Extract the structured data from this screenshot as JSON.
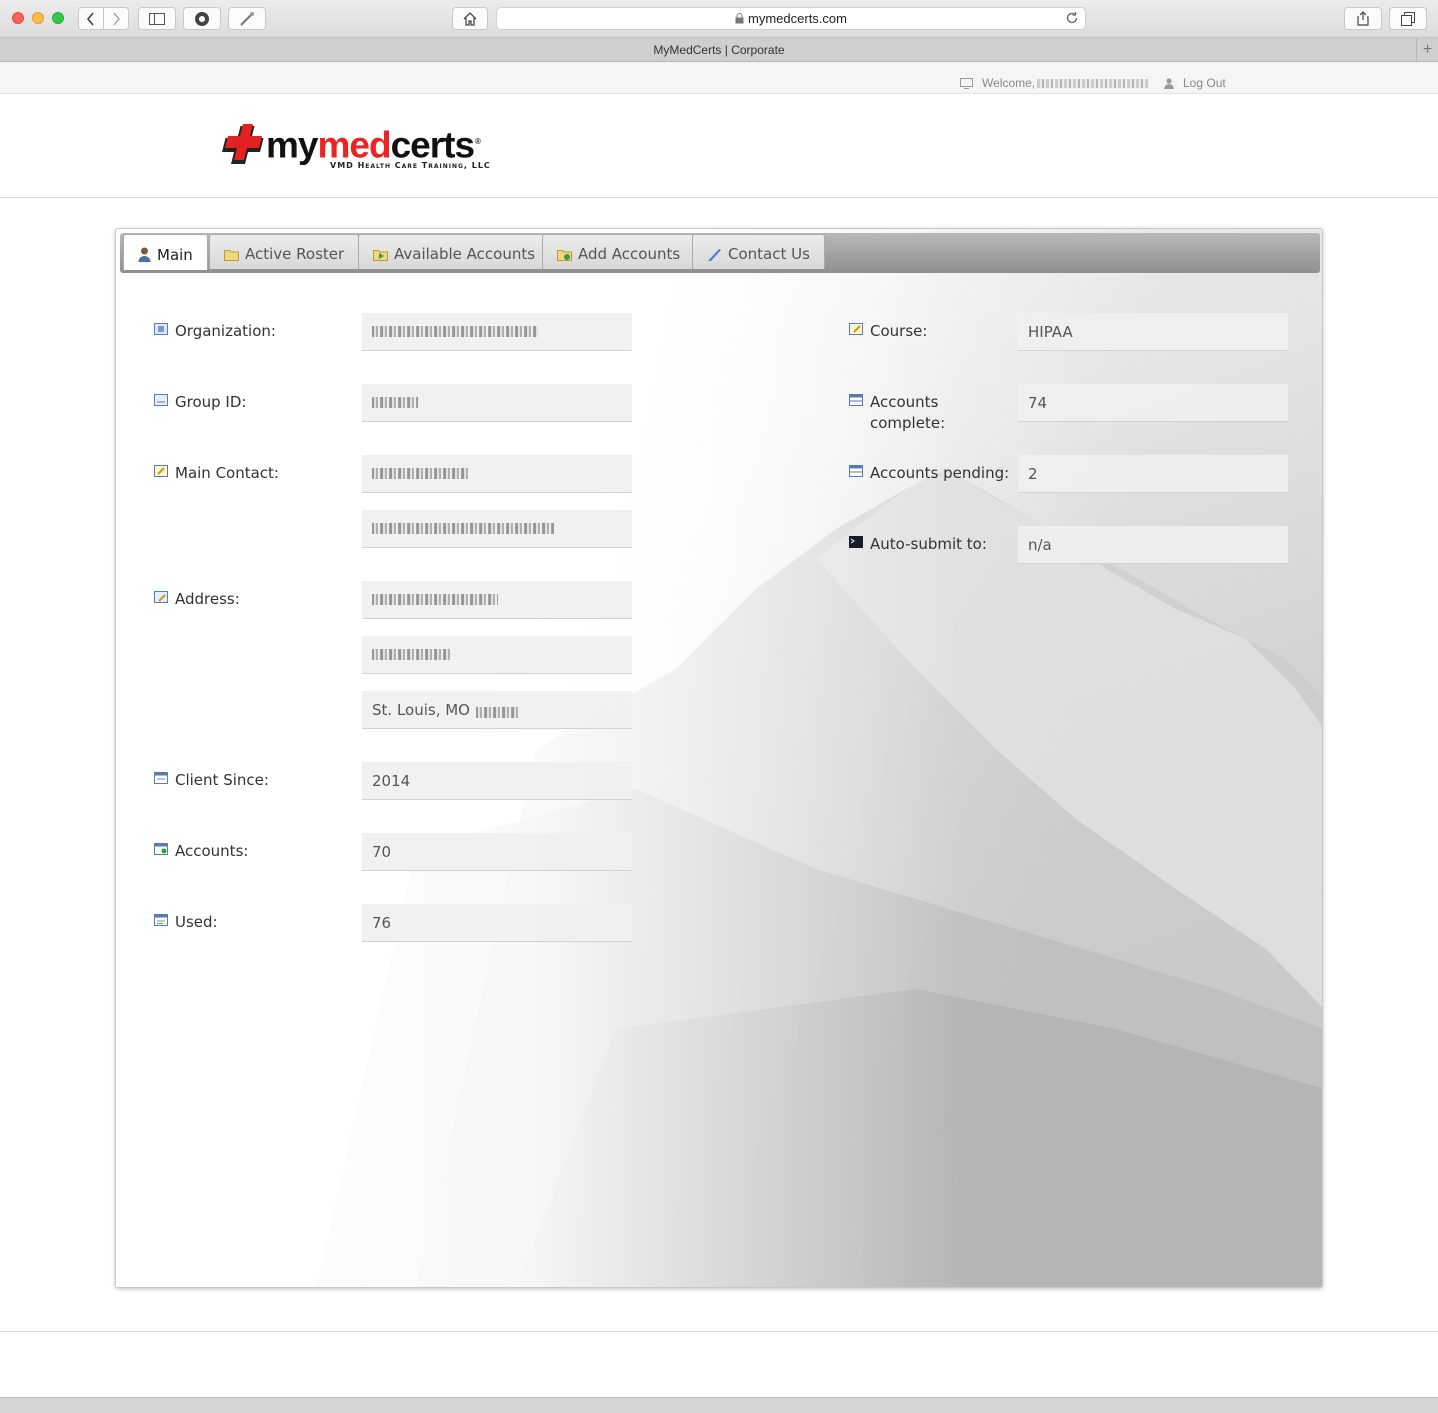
{
  "browser": {
    "url": "mymedcerts.com",
    "tab_title": "MyMedCerts | Corporate",
    "new_tab_label": "+"
  },
  "topbar": {
    "welcome_label": "Welcome,",
    "logout_label": "Log Out"
  },
  "logo": {
    "text_part1": "my",
    "text_part2": "med",
    "text_part3": "certs",
    "registered": "®",
    "subtitle": "VMD Health Care Training, LLC"
  },
  "tabs": [
    {
      "label": "Main",
      "icon": "user-icon",
      "active": true
    },
    {
      "label": "Active Roster",
      "icon": "folder-icon"
    },
    {
      "label": "Available Accounts",
      "icon": "folder-arrow-icon"
    },
    {
      "label": "Add Accounts",
      "icon": "folder-add-icon"
    },
    {
      "label": "Contact Us",
      "icon": "quill-icon"
    }
  ],
  "main": {
    "left": {
      "organization_label": "Organization:",
      "group_id_label": "Group ID:",
      "main_contact_label": "Main Contact:",
      "address_label": "Address:",
      "address_line3": "St. Louis, MO",
      "client_since_label": "Client Since:",
      "client_since_value": "2014",
      "accounts_label": "Accounts:",
      "accounts_value": "70",
      "used_label": "Used:",
      "used_value": "76"
    },
    "right": {
      "course_label": "Course:",
      "course_value": "HIPAA",
      "accounts_complete_label": "Accounts complete:",
      "accounts_complete_value": "74",
      "accounts_pending_label": "Accounts pending:",
      "accounts_pending_value": "2",
      "auto_submit_label": "Auto-submit to:",
      "auto_submit_value": "n/a"
    }
  },
  "colors": {
    "brand_red": "#e22222",
    "tabstrip": "#9a9a9a"
  }
}
